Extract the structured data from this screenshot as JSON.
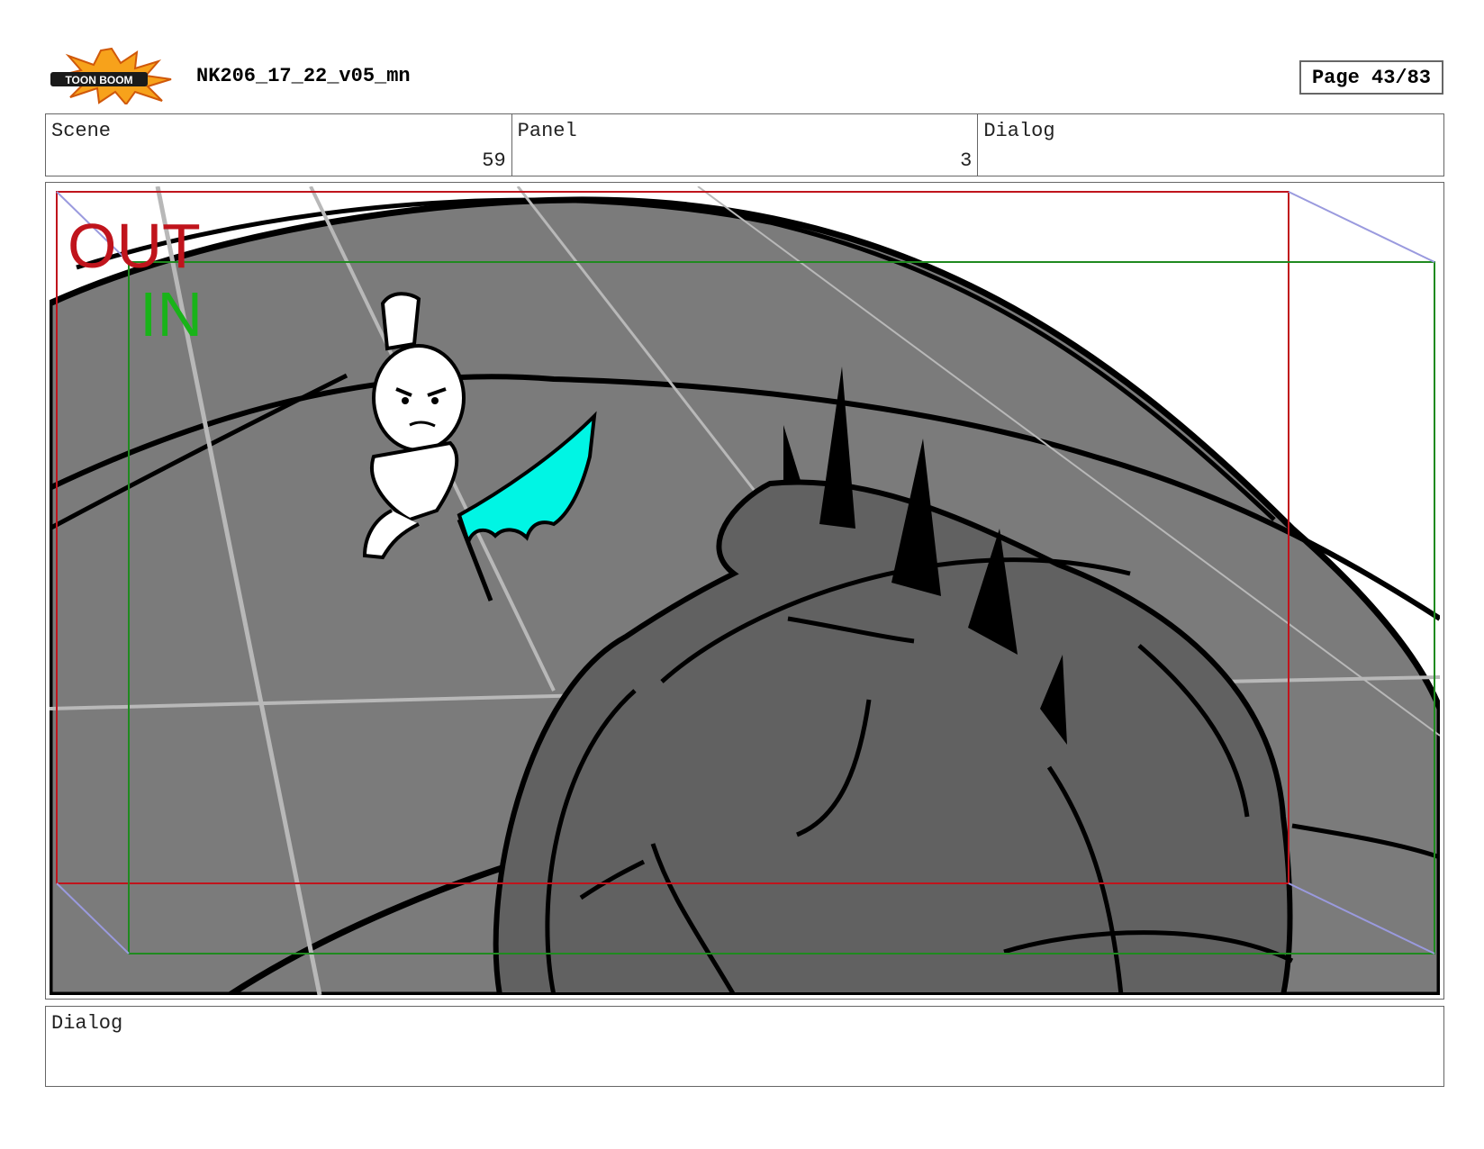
{
  "header": {
    "logo_text": "TOON BOOM",
    "document_title": "NK206_17_22_v05_mn",
    "page_indicator": "Page 43/83"
  },
  "info_row": {
    "scene_label": "Scene",
    "scene_value": "59",
    "panel_label": "Panel",
    "panel_value": "3",
    "dialog_label": "Dialog"
  },
  "panel": {
    "out_label": "OUT",
    "in_label": "IN",
    "colors": {
      "out_frame": "#c0141c",
      "in_frame": "#1f8a1f",
      "blade": "#00f5e4",
      "background_gray": "#7b7b7b",
      "creature_gray": "#5f5f5f"
    }
  },
  "dialog_box": {
    "label": "Dialog"
  }
}
